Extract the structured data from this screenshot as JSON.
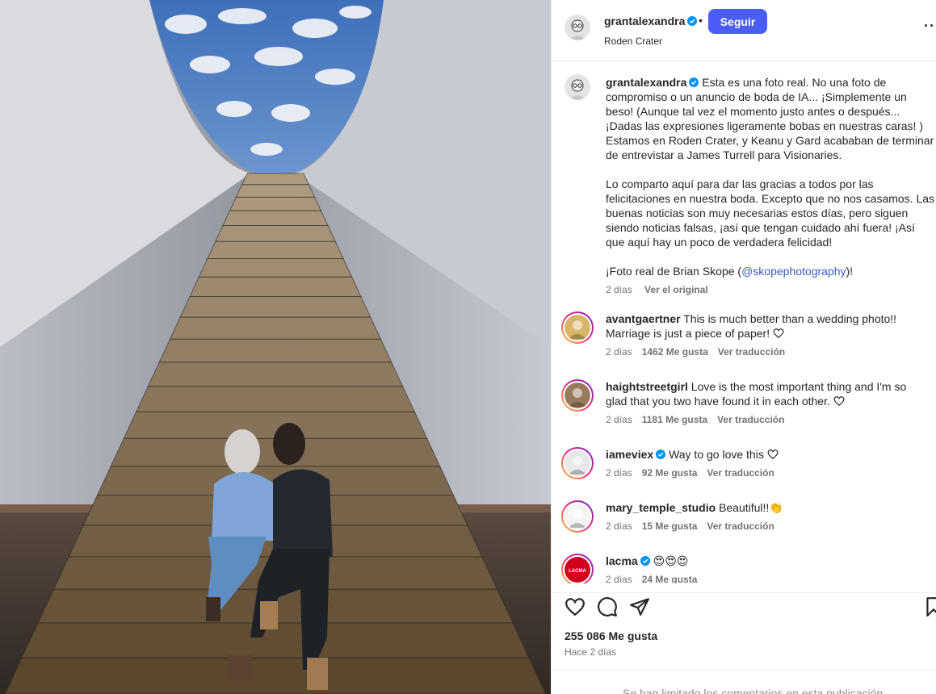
{
  "post": {
    "author": "grantalexandra",
    "location": "Roden Crater",
    "follow_label": "Seguir",
    "separator": "•",
    "more_label": "···"
  },
  "caption": {
    "username": "grantalexandra",
    "paragraph_1": "Esta es una foto real. No una foto de compromiso o un anuncio de boda de IA... ¡Simplemente un beso! (Aunque tal vez el momento justo antes o después... ¡Dadas las expresiones ligeramente bobas en nuestras caras! ) Estamos en Roden Crater, y Keanu y Gard acababan de terminar de entrevistar a James Turrell para Visionaries.",
    "paragraph_2": "Lo comparto aquí para dar las gracias a todos por las felicitaciones en nuestra boda. Excepto que no nos casamos. Las buenas noticias son muy necesarias estos días, pero siguen siendo noticias falsas, ¡así que tengan cuidado ahí fuera! ¡Así que aquí hay un poco de verdadera felicidad!",
    "credit_prefix": "¡Foto real de Brian Skope (",
    "credit_mention": "@skopephotography",
    "credit_suffix": ")!",
    "time": "2 días",
    "see_original": "Ver el original"
  },
  "comments": [
    {
      "username": "avantgaertner",
      "text": "This is much better than a wedding photo!! Marriage is just a piece of paper!",
      "time": "2 días",
      "likes": "1462 Me gusta",
      "translate": "Ver traducción",
      "verified": false
    },
    {
      "username": "haightstreetgirl",
      "text": "Love is the most important thing and I'm so glad that you two have found it in each other.",
      "time": "2 días",
      "likes": "1181 Me gusta",
      "translate": "Ver traducción",
      "verified": false
    },
    {
      "username": "iameviex",
      "text": "Way to go love this",
      "time": "2 días",
      "likes": "92 Me gusta",
      "translate": "Ver traducción",
      "verified": true
    },
    {
      "username": "mary_temple_studio",
      "text": "Beautiful!!👏",
      "time": "2 días",
      "likes": "15 Me gusta",
      "translate": "Ver traducción",
      "verified": false
    },
    {
      "username": "lacma",
      "text": "😍😍😍",
      "time": "2 días",
      "likes": "24 Me gusta",
      "translate": "",
      "verified": true,
      "avatar_text": "LACMA"
    }
  ],
  "footer": {
    "likes": "255 086 Me gusta",
    "ago": "Hace 2 días",
    "disabled_notice": "Se han limitado los comentarios en esta publicación."
  },
  "colors": {
    "accent": "#4a5df9",
    "verified": "#0095f6",
    "mention": "#3a5ec2",
    "muted": "#737373"
  },
  "icons": [
    "verified-badge-icon",
    "heart-icon",
    "comment-icon",
    "share-icon",
    "save-icon",
    "more-options-icon"
  ]
}
